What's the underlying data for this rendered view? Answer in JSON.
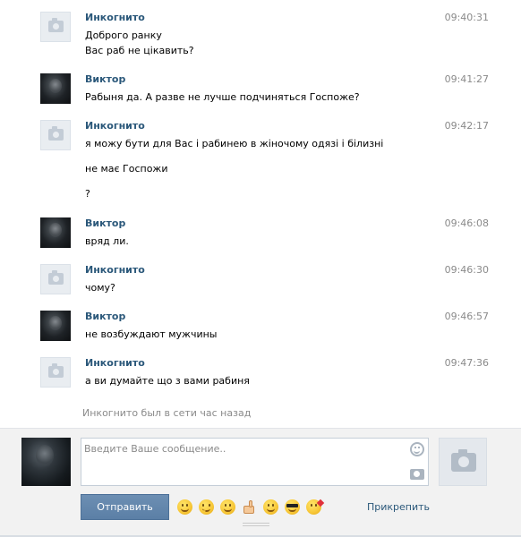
{
  "messages": [
    {
      "author": "Инкогнито",
      "time": "09:40:31",
      "avatar": "camera-placeholder-icon",
      "lines": [
        "Доброго ранку",
        "Вас раб не цікавить?"
      ]
    },
    {
      "author": "Виктор",
      "time": "09:41:27",
      "avatar": "user-photo",
      "lines": [
        "Рабыня да. А разве не лучше подчиняться Госпоже?"
      ]
    },
    {
      "author": "Инкогнито",
      "time": "09:42:17",
      "avatar": "camera-placeholder-icon",
      "lines": [
        "я можу бути для Вас і рабинею в жіночому одязі і білизні",
        "не має Госпожи",
        "?"
      ]
    },
    {
      "author": "Виктор",
      "time": "09:46:08",
      "avatar": "user-photo",
      "lines": [
        "вряд ли."
      ]
    },
    {
      "author": "Инкогнито",
      "time": "09:46:30",
      "avatar": "camera-placeholder-icon",
      "lines": [
        "чому?"
      ]
    },
    {
      "author": "Виктор",
      "time": "09:46:57",
      "avatar": "user-photo",
      "lines": [
        "не возбуждают мужчины"
      ]
    },
    {
      "author": "Инкогнито",
      "time": "09:47:36",
      "avatar": "camera-placeholder-icon",
      "lines": [
        "а ви думайте що з вами рабиня"
      ]
    }
  ],
  "status": "Инкогнито был в сети час назад",
  "composer": {
    "placeholder": "Введите Ваше сообщение..",
    "send_label": "Отправить",
    "attach_label": "Прикрепить",
    "emoji_icons": [
      "grin-emoji-icon",
      "nervous-emoji-icon",
      "smile-emoji-icon",
      "thumbs-up-emoji-icon",
      "blush-emoji-icon",
      "sunglasses-emoji-icon",
      "kiss-emoji-icon"
    ]
  }
}
